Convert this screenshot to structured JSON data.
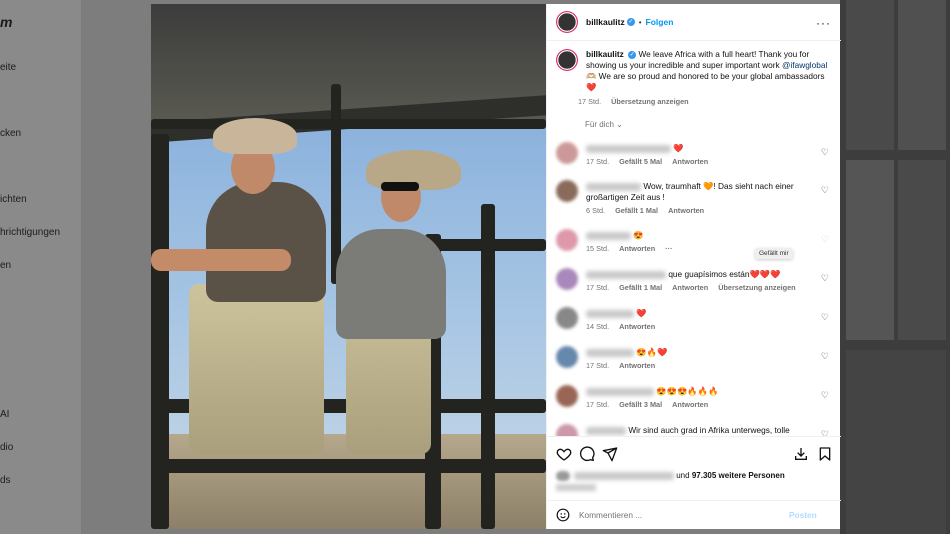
{
  "background": {
    "logo": "m",
    "nav": [
      "eite",
      "",
      "cken",
      "ichten",
      "hrichtigungen",
      "en",
      "AI",
      "dio",
      "ds"
    ]
  },
  "post": {
    "username": "billkaulitz",
    "follow_label": "Folgen",
    "dot": "•",
    "more_label": "···",
    "caption": {
      "part1": "We leave Africa with a full heart! Thank you for showing us your incredible and super important work",
      "mention": "@ifawglobal",
      "part2": "🫶🏼 We are so proud and honored to be your global ambassadors ❤️",
      "time": "17 Std.",
      "translate": "Übersetzung anzeigen"
    },
    "sort_label": "Für dich ⌄",
    "tooltip": "Gefällt mir",
    "comments": [
      {
        "text": "❤️",
        "time": "17 Std.",
        "likes": "Gefällt 5 Mal",
        "reply": "Antworten",
        "extra": ""
      },
      {
        "text": "Wow, traumhaft 🧡! Das sieht nach einer großartigen Zeit aus !",
        "time": "6 Std.",
        "likes": "Gefällt 1 Mal",
        "reply": "Antworten",
        "extra": ""
      },
      {
        "text": "😍",
        "time": "15 Std.",
        "likes": "",
        "reply": "Antworten",
        "extra": "···"
      },
      {
        "text": "que guapísimos están❤️❤️❤️",
        "time": "17 Std.",
        "likes": "Gefällt 1 Mal",
        "reply": "Antworten",
        "extra": "Übersetzung anzeigen"
      },
      {
        "text": "❤️",
        "time": "14 Std.",
        "likes": "",
        "reply": "Antworten",
        "extra": ""
      },
      {
        "text": "😍🔥❤️",
        "time": "17 Std.",
        "likes": "",
        "reply": "Antworten",
        "extra": ""
      },
      {
        "text": "😍😍😍🔥🔥🔥",
        "time": "17 Std.",
        "likes": "Gefällt 3 Mal",
        "reply": "Antworten",
        "extra": ""
      },
      {
        "text": "Wir sind auch grad in Afrika unterwegs, tolle",
        "time": "",
        "likes": "",
        "reply": "",
        "extra": ""
      }
    ],
    "likes_text": "und",
    "likes_count": "97.305 weitere Personen",
    "comment_placeholder": "Kommentieren ...",
    "post_label": "Posten"
  },
  "colors": {
    "accent": "#0095f6",
    "verified": "#3897f0",
    "muted": "#737373",
    "heart": "#ed4956"
  }
}
